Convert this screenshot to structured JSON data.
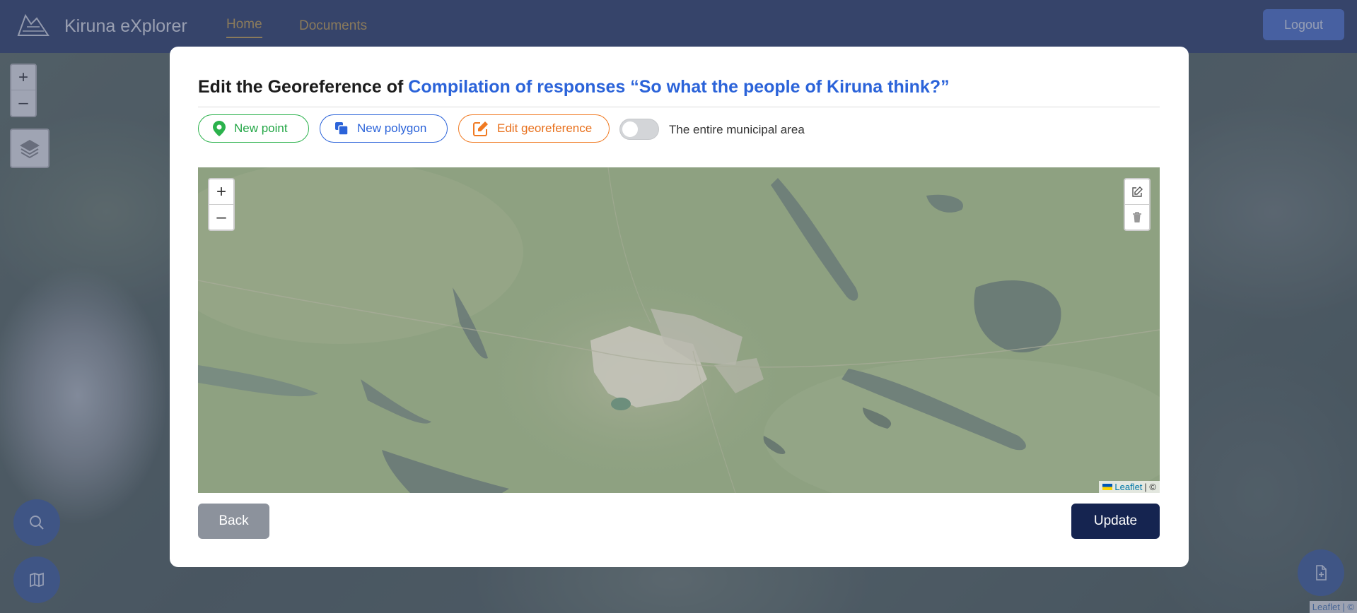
{
  "app": {
    "title": "Kiruna eXplorer",
    "nav": [
      {
        "label": "Home",
        "active": true
      },
      {
        "label": "Documents",
        "active": false
      }
    ],
    "logout_label": "Logout",
    "zoom_in": "+",
    "zoom_out": "–",
    "attribution": "Leaflet | ©",
    "accent_color": "#c9a24a"
  },
  "modal": {
    "title_prefix": "Edit the Georeference of ",
    "document_name": "Compilation of responses “So what the people of Kiruna think?”",
    "buttons": {
      "new_point": "New point",
      "new_polygon": "New polygon",
      "edit_georeference": "Edit georeference"
    },
    "toggle": {
      "label": "The entire municipal area",
      "checked": false
    },
    "map": {
      "zoom_in": "+",
      "zoom_out": "–",
      "attribution_link": "Leaflet",
      "attribution_rest": "| ©"
    },
    "back_label": "Back",
    "update_label": "Update",
    "colors": {
      "point": "#2bb24c",
      "polygon": "#2b63d9",
      "edit": "#f07a22",
      "update_bg": "#152450",
      "back_bg": "#8c929c"
    }
  }
}
